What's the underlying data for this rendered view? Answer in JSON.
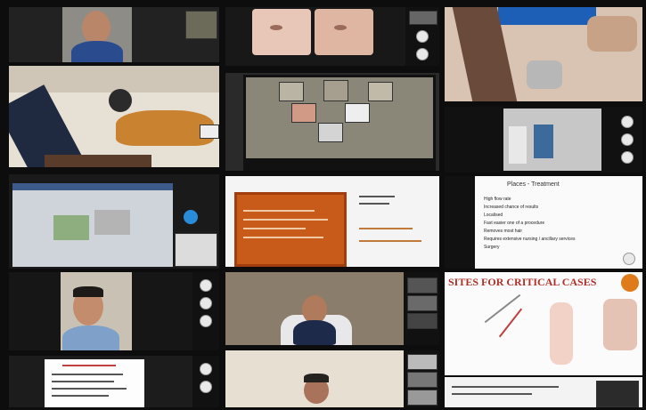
{
  "screenshot": {
    "description_hidden": false,
    "tiles": {
      "t9": {
        "slide_title": "Places - Treatment",
        "bullets": [
          "High flow rate",
          "Increased chance of results",
          "Localised",
          "Fast easier one of a procedure",
          "Removes most hair",
          "Requires extensive nursing / ancillary services",
          "Surgery"
        ]
      },
      "t11": {
        "heading": "SITES FOR CRITICAL CASES"
      }
    }
  }
}
